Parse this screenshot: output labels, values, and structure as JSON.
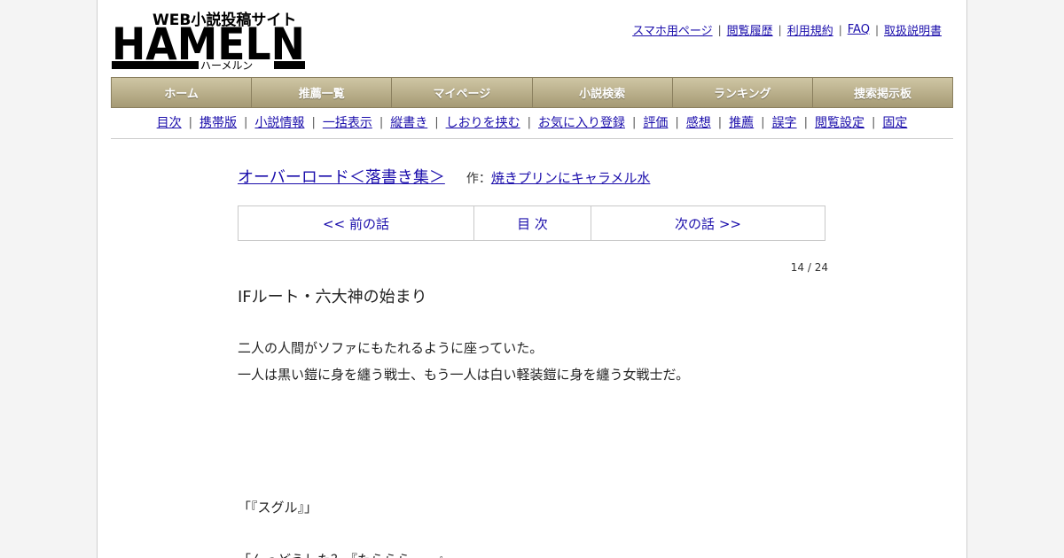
{
  "header": {
    "logo_tagline": "WEB小説投稿サイト",
    "logo_brand": "HAMELN",
    "logo_kana": "ハーメルン",
    "top_links": [
      "スマホ用ページ",
      "閲覧履歴",
      "利用規約",
      "FAQ",
      "取扱説明書"
    ]
  },
  "nav": [
    "ホーム",
    "推薦一覧",
    "マイページ",
    "小説検索",
    "ランキング",
    "捜索掲示板"
  ],
  "subnav": [
    "目次",
    "携帯版",
    "小説情報",
    "一括表示",
    "縦書き",
    "しおりを挟む",
    "お気に入り登録",
    "評価",
    "感想",
    "推薦",
    "誤字",
    "閲覧設定",
    "固定"
  ],
  "novel": {
    "title": "オーバーロード＜落書き集＞",
    "author_label": "作：",
    "author": "焼きプリンにキャラメル水"
  },
  "episode_nav": {
    "prev": "<< 前の話",
    "toc": "目 次",
    "next": "次の話 >>"
  },
  "page_count": "14 / 24",
  "chapter_title": "IFルート・六大神の始まり",
  "body_lines": [
    "二人の人間がソファにもたれるように座っていた。",
    "一人は黒い鎧に身を纏う戦士、もう一人は白い軽装鎧に身を纏う女戦士だ。",
    "「『スグル』」",
    "「んっどうした？『たらららーー』"
  ]
}
